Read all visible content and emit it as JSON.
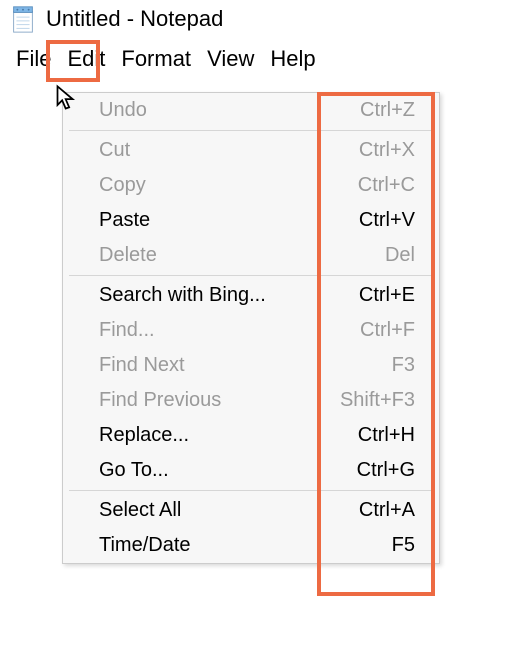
{
  "title_bar": {
    "title": "Untitled - Notepad"
  },
  "menu_bar": {
    "items": [
      {
        "label": "File"
      },
      {
        "label": "Edit"
      },
      {
        "label": "Format"
      },
      {
        "label": "View"
      },
      {
        "label": "Help"
      }
    ]
  },
  "dropdown": {
    "group1": [
      {
        "label": "Undo",
        "shortcut": "Ctrl+Z",
        "enabled": false
      }
    ],
    "group2": [
      {
        "label": "Cut",
        "shortcut": "Ctrl+X",
        "enabled": false
      },
      {
        "label": "Copy",
        "shortcut": "Ctrl+C",
        "enabled": false
      },
      {
        "label": "Paste",
        "shortcut": "Ctrl+V",
        "enabled": true
      },
      {
        "label": "Delete",
        "shortcut": "Del",
        "enabled": false
      }
    ],
    "group3": [
      {
        "label": "Search with Bing...",
        "shortcut": "Ctrl+E",
        "enabled": true
      },
      {
        "label": "Find...",
        "shortcut": "Ctrl+F",
        "enabled": false
      },
      {
        "label": "Find Next",
        "shortcut": "F3",
        "enabled": false
      },
      {
        "label": "Find Previous",
        "shortcut": "Shift+F3",
        "enabled": false
      },
      {
        "label": "Replace...",
        "shortcut": "Ctrl+H",
        "enabled": true
      },
      {
        "label": "Go To...",
        "shortcut": "Ctrl+G",
        "enabled": true
      }
    ],
    "group4": [
      {
        "label": "Select All",
        "shortcut": "Ctrl+A",
        "enabled": true
      },
      {
        "label": "Time/Date",
        "shortcut": "F5",
        "enabled": true
      }
    ]
  }
}
